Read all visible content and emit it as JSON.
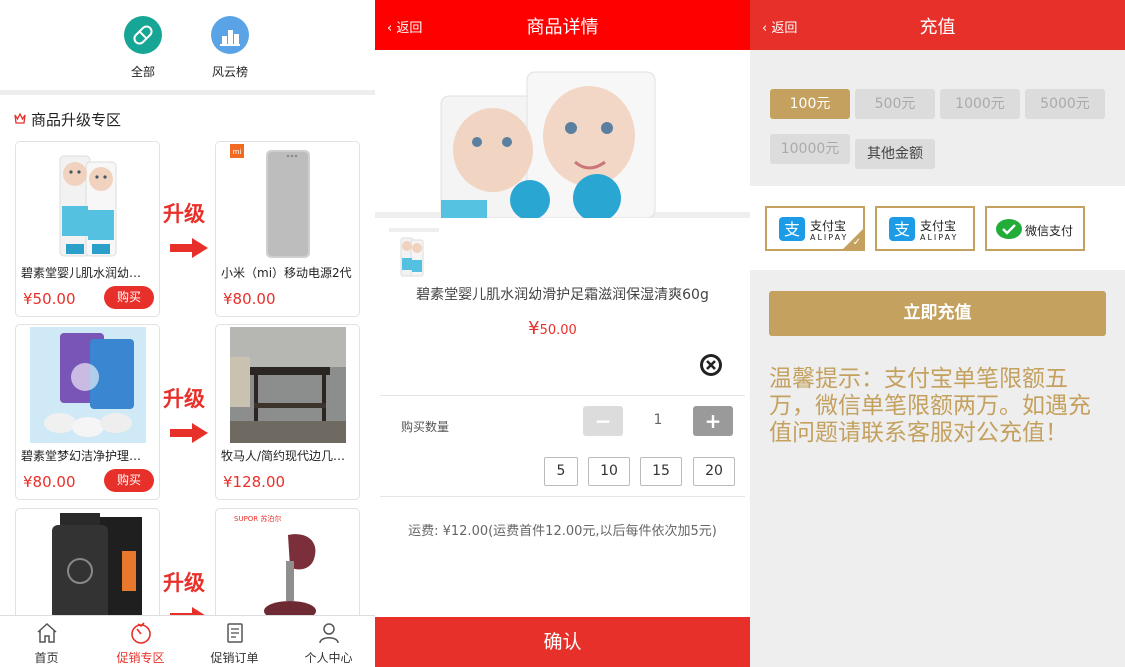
{
  "colors": {
    "red": "#e8302a",
    "gold": "#c4a15e",
    "grey_bg": "#eeeeee"
  },
  "home": {
    "categories": [
      {
        "label": "全部",
        "icon": "pill-icon",
        "color": "#17a695"
      },
      {
        "label": "风云榜",
        "icon": "ranking-icon",
        "color": "#5aa3e6"
      }
    ],
    "section_title": "商品升级专区",
    "upgrade_label": "升级",
    "products_left": [
      {
        "name": "碧素堂婴儿肌水润幼滑护足霜",
        "price": "¥50.00",
        "buy": "购买"
      },
      {
        "name": "碧素堂梦幻洁净护理兰花洗衣液",
        "price": "¥80.00",
        "buy": "购买"
      },
      {
        "name": "",
        "price": "",
        "buy": ""
      }
    ],
    "products_right": [
      {
        "name": "小米（mi）移动电源2代",
        "price": "¥80.00",
        "brand": "mi"
      },
      {
        "name": "牧马人/简约现代边几茶几",
        "price": "¥128.00",
        "brand": ""
      },
      {
        "name": "",
        "price": "",
        "brand": "SUPOR 苏泊尔"
      }
    ],
    "tabs": [
      {
        "label": "首页",
        "icon": "home-icon"
      },
      {
        "label": "促销专区",
        "icon": "promotion-icon"
      },
      {
        "label": "促销订单",
        "icon": "order-icon"
      },
      {
        "label": "个人中心",
        "icon": "user-icon"
      }
    ],
    "active_tab": "促销专区"
  },
  "detail": {
    "back": "返回",
    "title": "商品详情",
    "product_name": "碧素堂婴儿肌水润幼滑护足霜滋润保湿清爽60g",
    "currency": "¥",
    "price": "50.00",
    "qty_label": "购买数量",
    "qty_minus": "−",
    "qty_value": "1",
    "qty_plus": "+",
    "presets": [
      "5",
      "10",
      "15",
      "20"
    ],
    "shipping": "运费: ¥12.00(运费首件12.00元,以后每件依次加5元)",
    "confirm": "确认"
  },
  "recharge": {
    "back": "返回",
    "title": "充值",
    "amounts": [
      "100元",
      "500元",
      "1000元",
      "5000元",
      "10000元"
    ],
    "other_amount": "其他金额",
    "selected_amount": "100元",
    "payments": [
      {
        "label": "支付宝",
        "sub": "ALIPAY",
        "icon": "alipay-icon",
        "selected": true
      },
      {
        "label": "支付宝",
        "sub": "ALIPAY",
        "icon": "alipay-icon",
        "selected": false
      },
      {
        "label": "微信支付",
        "sub": "",
        "icon": "wechat-pay-icon",
        "selected": false
      }
    ],
    "submit": "立即充值",
    "tips": "温馨提示：支付宝单笔限额五万，微信单笔限额两万。如遇充值问题请联系客服对公充值！"
  }
}
